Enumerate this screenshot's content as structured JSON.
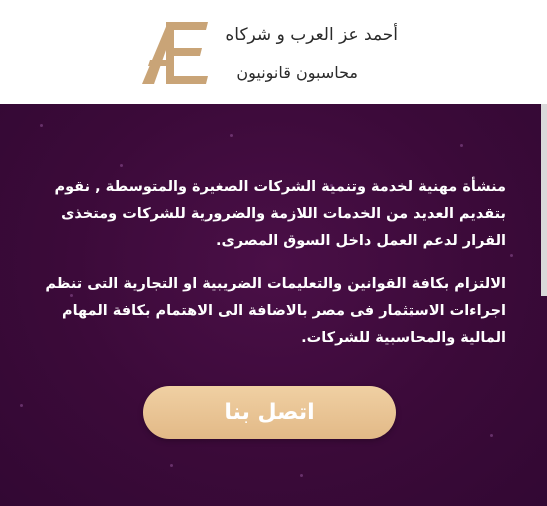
{
  "header": {
    "brand_name": "أحمد عز العرب و شركاه",
    "brand_subtitle": "محاسبون قانونيون",
    "logo_text": "Æ",
    "logo_color": "#c9a477"
  },
  "hero": {
    "paragraph_1": "منشأة مهنية لخدمة وتنمية الشركات الصغيرة والمتوسطة , نقوم بتقديم العديد من الخدمات اللازمة والضرورية للشركات ومتخذى القرار لدعم العمل داخل السوق المصرى.",
    "paragraph_2": "الالتزام بكافة القوانين والتعليمات الضريبية او التجارية التى تنظم اجراءات الاستثمار فى مصر بالاضافة الى الاهتمام بكافة المهام المالية والمحاسبية للشركات.",
    "cta_label": "اتصل بنا",
    "background_color": "#3a0a38",
    "cta_color": "#e8c497"
  }
}
